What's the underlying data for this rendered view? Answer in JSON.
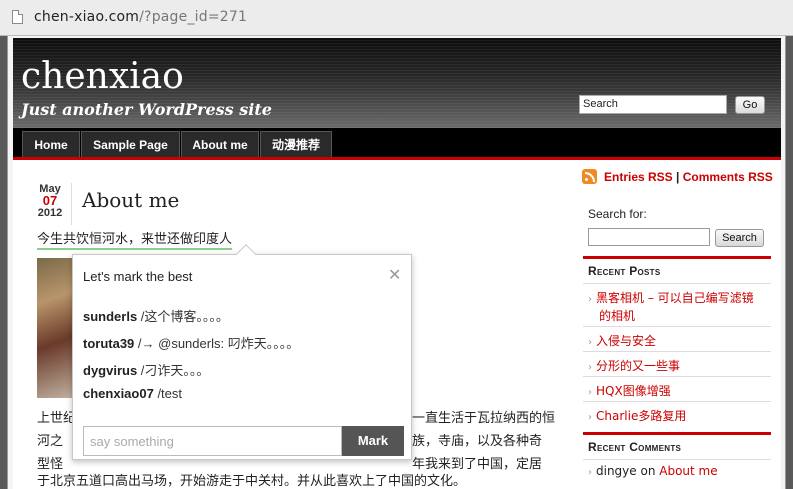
{
  "browser": {
    "url_host": "chen-xiao.com",
    "url_path": "/?page_id=271"
  },
  "header": {
    "site_title": "chenxiao",
    "site_description": "Just another WordPress site",
    "search_value": "Search",
    "search_button": "Go"
  },
  "nav": {
    "items": [
      "Home",
      "Sample Page",
      "About me",
      "动漫推荐"
    ]
  },
  "post": {
    "date_month": "May",
    "date_day": "07",
    "date_year": "2012",
    "title": "About me",
    "subtitle": "今生共饮恒河水，来世还做印度人",
    "body_lines": [
      "上世纪",
      "一直生活于瓦拉纳西的恒",
      "河之",
      "族，寺庙，以及各种奇",
      "型怪",
      "年我来到了中国，定居",
      "于北京五道口高出马场，开始游走于中关村。并从此喜欢上了中国的文化。"
    ]
  },
  "popup": {
    "title": "Let's mark the best",
    "close_symbol": "✕",
    "comments": [
      {
        "user": "sunderls",
        "text": " /这个博客。。。。"
      },
      {
        "user": "toruta39",
        "text": " /→ @sunderls: 叼炸天。。。。"
      },
      {
        "user": "dygvirus",
        "text": " /刁诈天。。。"
      },
      {
        "user": "chenxiao07",
        "text": " /test"
      }
    ],
    "input_placeholder": "say something",
    "mark_button": "Mark"
  },
  "sidebar": {
    "rss_entries": "Entries RSS",
    "rss_separator": " | ",
    "rss_comments": "Comments RSS",
    "search_label": "Search for:",
    "search_button": "Search",
    "recent_posts_title": "Recent Posts",
    "recent_posts": [
      "黑客相机 – 可以自己编写滤镜",
      "的相机",
      "入侵与安全",
      "分形的又一些事",
      "HQX图像增强",
      "Charlie多路复用"
    ],
    "recent_comments_title": "Recent Comments",
    "recent_comment_author": "dingye",
    "recent_comment_on": " on ",
    "recent_comment_post": "About me"
  },
  "colors": {
    "accent": "#cc0000",
    "nav_bg": "#000000",
    "popup_button": "#555555"
  }
}
